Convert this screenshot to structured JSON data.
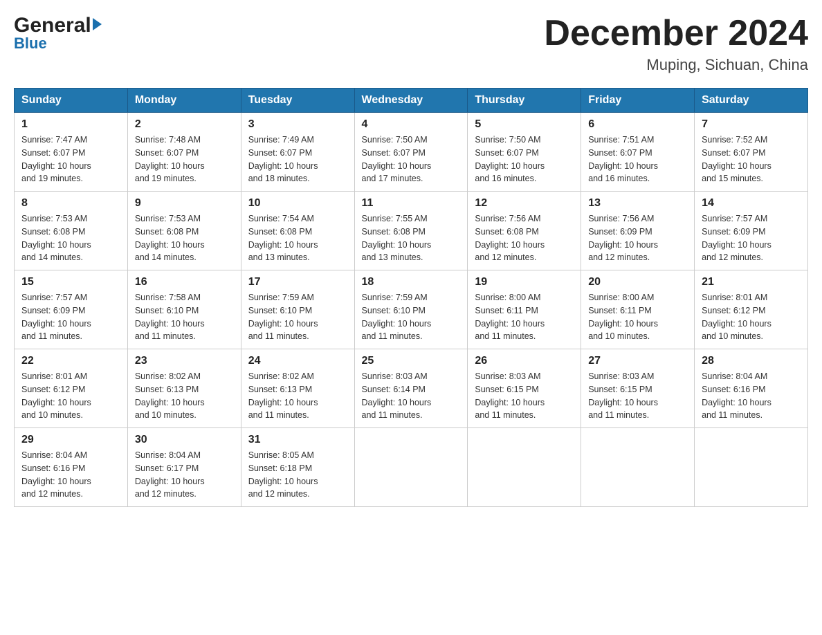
{
  "header": {
    "logo_general": "General",
    "logo_blue": "Blue",
    "month_title": "December 2024",
    "location": "Muping, Sichuan, China"
  },
  "days_of_week": [
    "Sunday",
    "Monday",
    "Tuesday",
    "Wednesday",
    "Thursday",
    "Friday",
    "Saturday"
  ],
  "weeks": [
    [
      {
        "day": "1",
        "sunrise": "7:47 AM",
        "sunset": "6:07 PM",
        "daylight": "10 hours and 19 minutes."
      },
      {
        "day": "2",
        "sunrise": "7:48 AM",
        "sunset": "6:07 PM",
        "daylight": "10 hours and 19 minutes."
      },
      {
        "day": "3",
        "sunrise": "7:49 AM",
        "sunset": "6:07 PM",
        "daylight": "10 hours and 18 minutes."
      },
      {
        "day": "4",
        "sunrise": "7:50 AM",
        "sunset": "6:07 PM",
        "daylight": "10 hours and 17 minutes."
      },
      {
        "day": "5",
        "sunrise": "7:50 AM",
        "sunset": "6:07 PM",
        "daylight": "10 hours and 16 minutes."
      },
      {
        "day": "6",
        "sunrise": "7:51 AM",
        "sunset": "6:07 PM",
        "daylight": "10 hours and 16 minutes."
      },
      {
        "day": "7",
        "sunrise": "7:52 AM",
        "sunset": "6:07 PM",
        "daylight": "10 hours and 15 minutes."
      }
    ],
    [
      {
        "day": "8",
        "sunrise": "7:53 AM",
        "sunset": "6:08 PM",
        "daylight": "10 hours and 14 minutes."
      },
      {
        "day": "9",
        "sunrise": "7:53 AM",
        "sunset": "6:08 PM",
        "daylight": "10 hours and 14 minutes."
      },
      {
        "day": "10",
        "sunrise": "7:54 AM",
        "sunset": "6:08 PM",
        "daylight": "10 hours and 13 minutes."
      },
      {
        "day": "11",
        "sunrise": "7:55 AM",
        "sunset": "6:08 PM",
        "daylight": "10 hours and 13 minutes."
      },
      {
        "day": "12",
        "sunrise": "7:56 AM",
        "sunset": "6:08 PM",
        "daylight": "10 hours and 12 minutes."
      },
      {
        "day": "13",
        "sunrise": "7:56 AM",
        "sunset": "6:09 PM",
        "daylight": "10 hours and 12 minutes."
      },
      {
        "day": "14",
        "sunrise": "7:57 AM",
        "sunset": "6:09 PM",
        "daylight": "10 hours and 12 minutes."
      }
    ],
    [
      {
        "day": "15",
        "sunrise": "7:57 AM",
        "sunset": "6:09 PM",
        "daylight": "10 hours and 11 minutes."
      },
      {
        "day": "16",
        "sunrise": "7:58 AM",
        "sunset": "6:10 PM",
        "daylight": "10 hours and 11 minutes."
      },
      {
        "day": "17",
        "sunrise": "7:59 AM",
        "sunset": "6:10 PM",
        "daylight": "10 hours and 11 minutes."
      },
      {
        "day": "18",
        "sunrise": "7:59 AM",
        "sunset": "6:10 PM",
        "daylight": "10 hours and 11 minutes."
      },
      {
        "day": "19",
        "sunrise": "8:00 AM",
        "sunset": "6:11 PM",
        "daylight": "10 hours and 11 minutes."
      },
      {
        "day": "20",
        "sunrise": "8:00 AM",
        "sunset": "6:11 PM",
        "daylight": "10 hours and 10 minutes."
      },
      {
        "day": "21",
        "sunrise": "8:01 AM",
        "sunset": "6:12 PM",
        "daylight": "10 hours and 10 minutes."
      }
    ],
    [
      {
        "day": "22",
        "sunrise": "8:01 AM",
        "sunset": "6:12 PM",
        "daylight": "10 hours and 10 minutes."
      },
      {
        "day": "23",
        "sunrise": "8:02 AM",
        "sunset": "6:13 PM",
        "daylight": "10 hours and 10 minutes."
      },
      {
        "day": "24",
        "sunrise": "8:02 AM",
        "sunset": "6:13 PM",
        "daylight": "10 hours and 11 minutes."
      },
      {
        "day": "25",
        "sunrise": "8:03 AM",
        "sunset": "6:14 PM",
        "daylight": "10 hours and 11 minutes."
      },
      {
        "day": "26",
        "sunrise": "8:03 AM",
        "sunset": "6:15 PM",
        "daylight": "10 hours and 11 minutes."
      },
      {
        "day": "27",
        "sunrise": "8:03 AM",
        "sunset": "6:15 PM",
        "daylight": "10 hours and 11 minutes."
      },
      {
        "day": "28",
        "sunrise": "8:04 AM",
        "sunset": "6:16 PM",
        "daylight": "10 hours and 11 minutes."
      }
    ],
    [
      {
        "day": "29",
        "sunrise": "8:04 AM",
        "sunset": "6:16 PM",
        "daylight": "10 hours and 12 minutes."
      },
      {
        "day": "30",
        "sunrise": "8:04 AM",
        "sunset": "6:17 PM",
        "daylight": "10 hours and 12 minutes."
      },
      {
        "day": "31",
        "sunrise": "8:05 AM",
        "sunset": "6:18 PM",
        "daylight": "10 hours and 12 minutes."
      },
      null,
      null,
      null,
      null
    ]
  ],
  "labels": {
    "sunrise": "Sunrise:",
    "sunset": "Sunset:",
    "daylight": "Daylight:"
  }
}
